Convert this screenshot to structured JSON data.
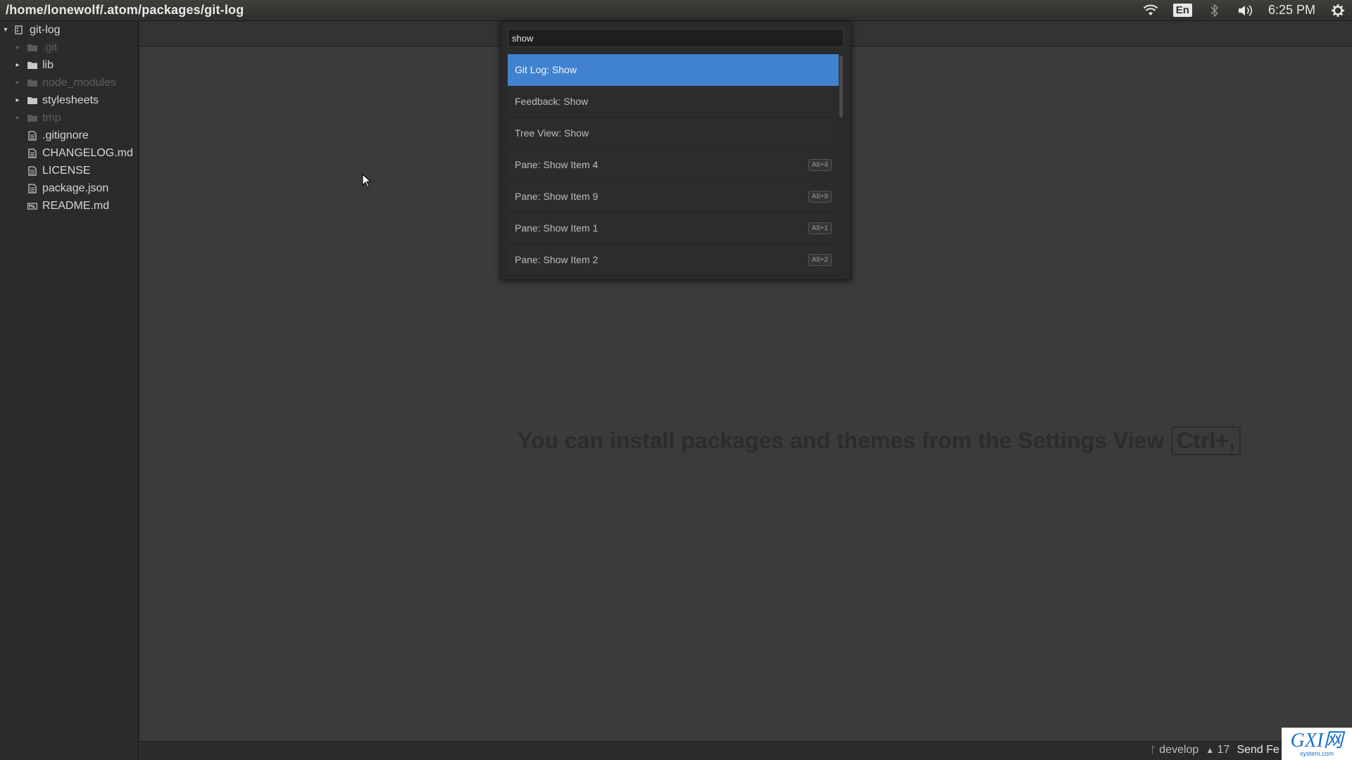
{
  "window": {
    "title": "/home/lonewolf/.atom/packages/git-log"
  },
  "tray": {
    "language": "En",
    "clock": "6:25 PM"
  },
  "tree": {
    "root": {
      "label": "git-log"
    },
    "items": [
      {
        "label": ".git",
        "type": "folder",
        "dim": true
      },
      {
        "label": "lib",
        "type": "folder",
        "dim": false
      },
      {
        "label": "node_modules",
        "type": "folder",
        "dim": true
      },
      {
        "label": "stylesheets",
        "type": "folder",
        "dim": false
      },
      {
        "label": "tmp",
        "type": "folder",
        "dim": true
      },
      {
        "label": ".gitignore",
        "type": "file",
        "dim": false
      },
      {
        "label": "CHANGELOG.md",
        "type": "file",
        "dim": false
      },
      {
        "label": "LICENSE",
        "type": "file",
        "dim": false
      },
      {
        "label": "package.json",
        "type": "file",
        "dim": false
      },
      {
        "label": "README.md",
        "type": "file-md",
        "dim": false
      }
    ]
  },
  "palette": {
    "query": "show",
    "items": [
      {
        "label": "Git Log: Show",
        "key": "",
        "selected": true
      },
      {
        "label": "Feedback: Show",
        "key": ""
      },
      {
        "label": "Tree View: Show",
        "key": ""
      },
      {
        "label": "Pane: Show Item 4",
        "key": "Alt+4"
      },
      {
        "label": "Pane: Show Item 9",
        "key": "Alt+9"
      },
      {
        "label": "Pane: Show Item 1",
        "key": "Alt+1"
      },
      {
        "label": "Pane: Show Item 2",
        "key": "Alt+2"
      }
    ]
  },
  "editor": {
    "hint": "You can install packages and themes from the Settings View",
    "hint_key": "Ctrl+,"
  },
  "status": {
    "branch": "develop",
    "ahead": "17",
    "feedback": "Send Fe"
  },
  "watermark": {
    "text": "GXI网",
    "subtext": "system.com"
  }
}
